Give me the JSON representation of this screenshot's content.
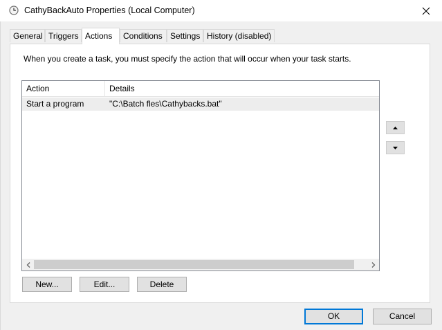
{
  "window": {
    "title": "CathyBackAuto Properties (Local Computer)",
    "title_icon": "task-scheduler-clock-icon",
    "close_icon": "close-icon"
  },
  "tabs": [
    {
      "label": "General",
      "active": false
    },
    {
      "label": "Triggers",
      "active": false
    },
    {
      "label": "Actions",
      "active": true
    },
    {
      "label": "Conditions",
      "active": false
    },
    {
      "label": "Settings",
      "active": false
    },
    {
      "label": "History (disabled)",
      "active": false
    }
  ],
  "actions_panel": {
    "intro": "When you create a task, you must specify the action that will occur when your task starts.",
    "columns": [
      "Action",
      "Details"
    ],
    "rows": [
      {
        "action": "Start a program",
        "details": "\"C:\\Batch fles\\Cathybacks.bat\""
      }
    ],
    "buttons": {
      "new": "New...",
      "edit": "Edit...",
      "delete": "Delete"
    }
  },
  "footer": {
    "ok": "OK",
    "cancel": "Cancel"
  },
  "colors": {
    "accent": "#0078d7",
    "selected_row": "#ededed"
  }
}
